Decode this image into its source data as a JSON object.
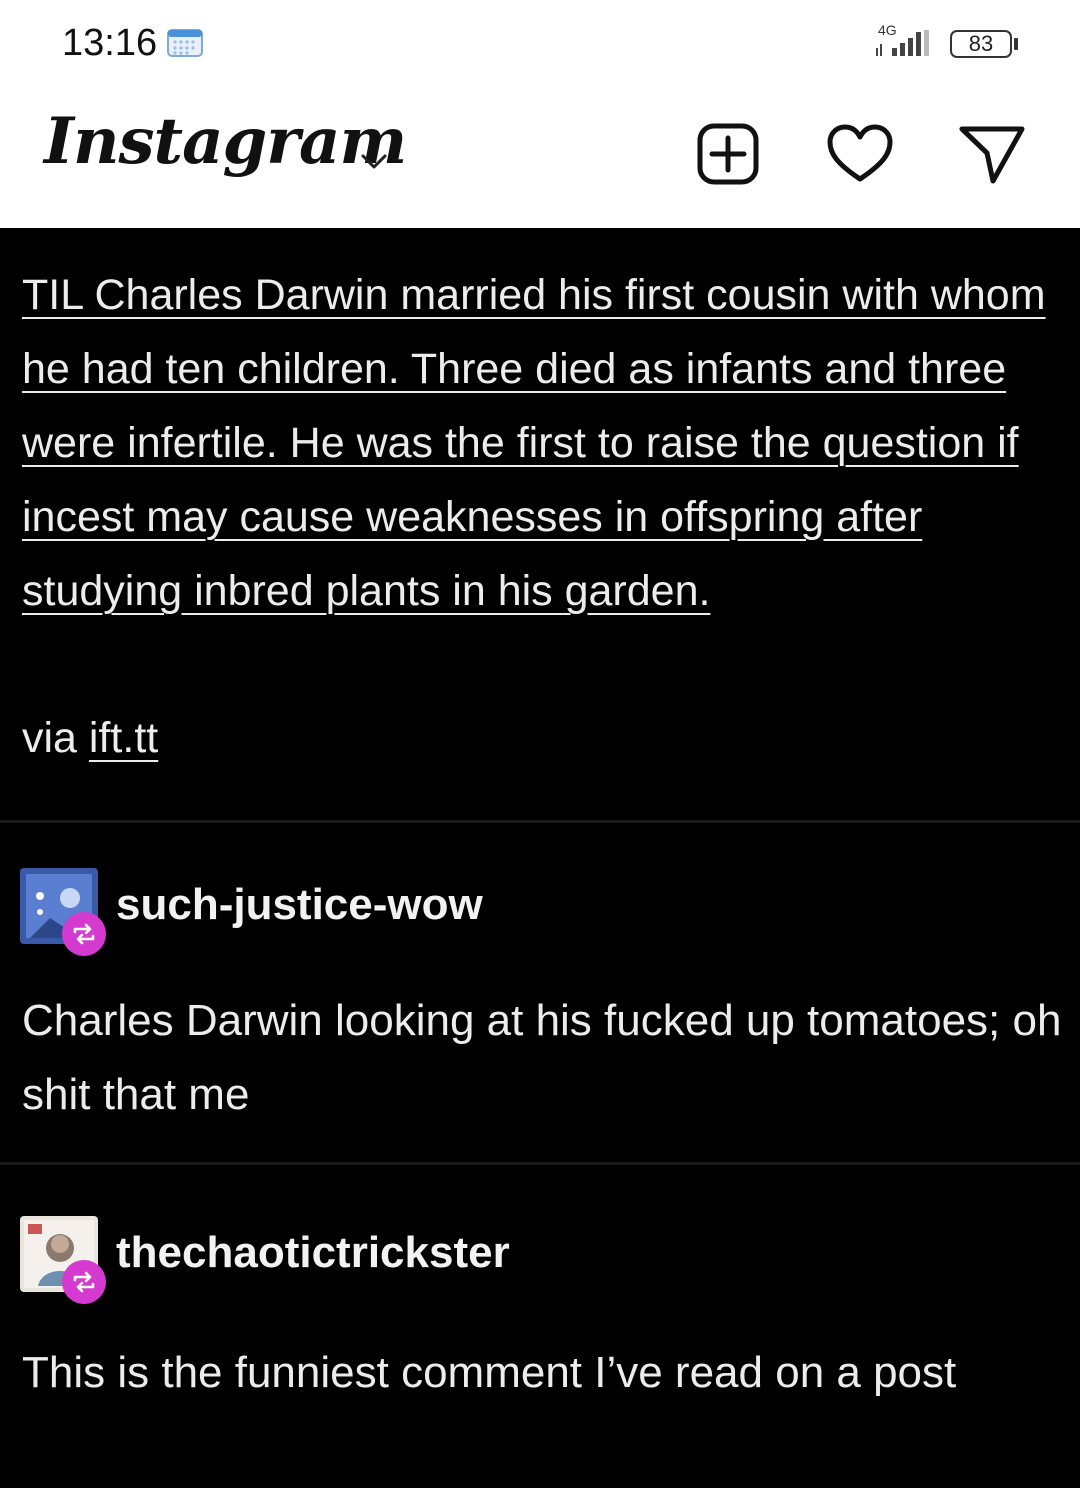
{
  "status_bar": {
    "time": "13:16",
    "network": "4G",
    "battery": "83"
  },
  "header": {
    "logo": "Instagram",
    "icons": [
      "chevron-down-icon",
      "add-post-icon",
      "heart-icon",
      "send-icon"
    ]
  },
  "post": {
    "headline": "TIL Charles Darwin married his first cousin with whom he had ten children. Three died as infants and three were infertile. He was the first to raise the question if incest may cause weaknesses in offspring after studying inbred plants in his garden.",
    "via_label": "via",
    "via_link": "ift.tt",
    "reblogs": [
      {
        "username": "such-justice-wow",
        "comment": "Charles Darwin looking at his fucked up tomatoes; oh shit that me"
      },
      {
        "username": "thechaotictrickster",
        "comment": "This is the funniest comment I’ve read on a post"
      }
    ]
  },
  "colors": {
    "background": "#000000",
    "text": "#ececec",
    "reblog_badge": "#d53ad0"
  }
}
